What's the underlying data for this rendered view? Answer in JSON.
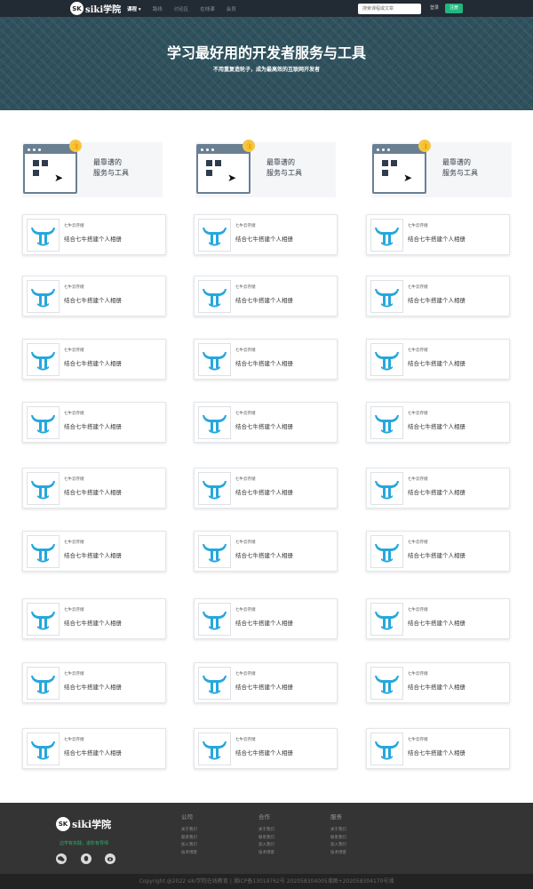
{
  "header": {
    "logo_badge": "SK",
    "logo_text": "siki学院",
    "nav": [
      "课程 ▾",
      "路线",
      "讨论区",
      "在线课",
      "会员"
    ],
    "search_placeholder": "搜索课程或文章",
    "login": "登录",
    "register": "注册"
  },
  "hero": {
    "title": "学习最好用的开发者服务与工具",
    "subtitle": "不用重复造轮子，成为最高效的互联网开发者"
  },
  "banners": [
    {
      "line1": "最靠谱的",
      "line2": "服务与工具"
    },
    {
      "line1": "最靠谱的",
      "line2": "服务与工具"
    },
    {
      "line1": "最靠谱的",
      "line2": "服务与工具"
    }
  ],
  "cards": [
    {
      "tag": "七牛云存储",
      "title": "结合七牛搭建个人相册"
    },
    {
      "tag": "七牛云存储",
      "title": "结合七牛搭建个人相册"
    },
    {
      "tag": "七牛云存储",
      "title": "结合七牛搭建个人相册"
    },
    {
      "tag": "七牛云存储",
      "title": "结合七牛搭建个人相册"
    },
    {
      "tag": "七牛云存储",
      "title": "结合七牛搭建个人相册"
    },
    {
      "tag": "七牛云存储",
      "title": "结合七牛搭建个人相册"
    },
    {
      "tag": "七牛云存储",
      "title": "结合七牛搭建个人相册"
    },
    {
      "tag": "七牛云存储",
      "title": "结合七牛搭建个人相册"
    },
    {
      "tag": "七牛云存储",
      "title": "结合七牛搭建个人相册"
    },
    {
      "tag": "七牛云存储",
      "title": "结合七牛搭建个人相册"
    },
    {
      "tag": "七牛云存储",
      "title": "结合七牛搭建个人相册"
    },
    {
      "tag": "七牛云存储",
      "title": "结合七牛搭建个人相册"
    },
    {
      "tag": "七牛云存储",
      "title": "结合七牛搭建个人相册"
    },
    {
      "tag": "七牛云存储",
      "title": "结合七牛搭建个人相册"
    },
    {
      "tag": "七牛云存储",
      "title": "结合七牛搭建个人相册"
    },
    {
      "tag": "七牛云存储",
      "title": "结合七牛搭建个人相册"
    },
    {
      "tag": "七牛云存储",
      "title": "结合七牛搭建个人相册"
    },
    {
      "tag": "七牛云存储",
      "title": "结合七牛搭建个人相册"
    },
    {
      "tag": "七牛云存储",
      "title": "结合七牛搭建个人相册"
    },
    {
      "tag": "七牛云存储",
      "title": "结合七牛搭建个人相册"
    },
    {
      "tag": "七牛云存储",
      "title": "结合七牛搭建个人相册"
    },
    {
      "tag": "七牛云存储",
      "title": "结合七牛搭建个人相册"
    },
    {
      "tag": "七牛云存储",
      "title": "结合七牛搭建个人相册"
    },
    {
      "tag": "七牛云存储",
      "title": "结合七牛搭建个人相册"
    },
    {
      "tag": "七牛云存储",
      "title": "结合七牛搭建个人相册"
    },
    {
      "tag": "七牛云存储",
      "title": "结合七牛搭建个人相册"
    },
    {
      "tag": "七牛云存储",
      "title": "结合七牛搭建个人相册"
    }
  ],
  "footer": {
    "logo_badge": "SK",
    "logo_text": "siki学院",
    "slogan": "边学有实践，进阶有导师",
    "social_icons": [
      "wechat-icon",
      "qq-icon",
      "weibo-icon"
    ],
    "columns": [
      {
        "title": "公司",
        "links": [
          "关于我们",
          "联系我们",
          "加入我们",
          "技术博客"
        ]
      },
      {
        "title": "合作",
        "links": [
          "关于我们",
          "联系我们",
          "加入我们",
          "技术博客"
        ]
      },
      {
        "title": "服务",
        "links": [
          "关于我们",
          "联系我们",
          "加入我们",
          "技术博客"
        ]
      }
    ],
    "copyright": "Copyright @2022 siki学院在线教育 | 湘ICP备13019762号 202058304005湘图+202058304170号湘"
  },
  "colors": {
    "navbar": "#222a33",
    "hero": "#2f525e",
    "accent_green": "#1fb87e",
    "qiniu_blue": "#26a7dc",
    "footer": "#343434"
  }
}
